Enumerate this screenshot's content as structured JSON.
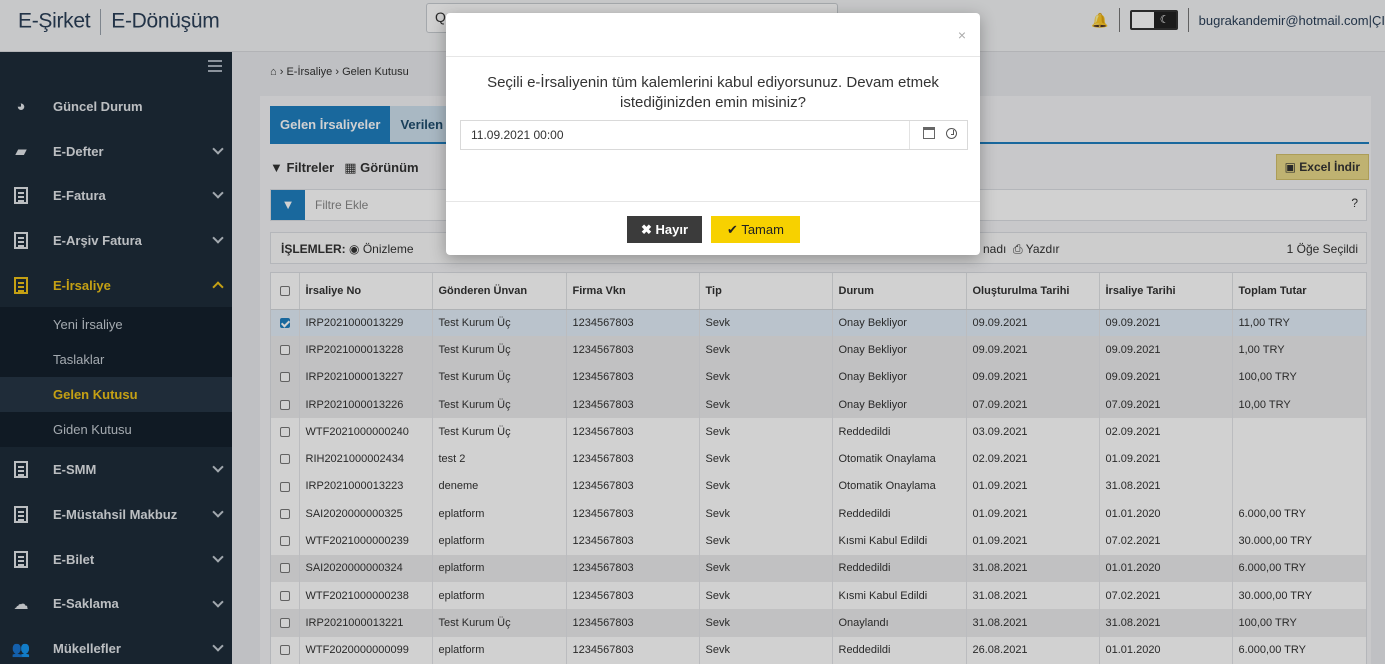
{
  "header": {
    "brand_left": "E-Şirket",
    "brand_right": "E-Dönüşüm",
    "user_email": "bugrakandemir@hotmail.com|ÇI"
  },
  "sidebar": {
    "items": [
      {
        "label": "Güncel Durum",
        "icon": "dashboard-icon"
      },
      {
        "label": "E-Defter",
        "icon": "book-icon"
      },
      {
        "label": "E-Fatura",
        "icon": "document-icon"
      },
      {
        "label": "E-Arşiv Fatura",
        "icon": "archive-icon"
      },
      {
        "label": "E-İrsaliye",
        "icon": "document-icon"
      },
      {
        "label": "E-SMM",
        "icon": "document-icon"
      },
      {
        "label": "E-Müstahsil Makbuz",
        "icon": "document-icon"
      },
      {
        "label": "E-Bilet",
        "icon": "document-icon"
      },
      {
        "label": "E-Saklama",
        "icon": "cloud-icon"
      },
      {
        "label": "Mükellefler",
        "icon": "users-icon"
      }
    ],
    "sub_items": [
      "Yeni İrsaliye",
      "Taslaklar",
      "Gelen Kutusu",
      "Giden Kutusu"
    ]
  },
  "breadcrumb": {
    "home": "E-İrsaliye",
    "current": "Gelen Kutusu"
  },
  "tabs": {
    "active": "Gelen İrsaliyeler",
    "other": "Verilen Cevaplar"
  },
  "toolbar": {
    "filters": "Filtreler",
    "view": "Görünüm",
    "excel": "Excel İndir",
    "filter_placeholder": "Filtre Ekle"
  },
  "ops": {
    "label": "İŞLEMLER:",
    "preview": "Önizleme",
    "partial": "nadı",
    "print": "Yazdır",
    "selected": "1 Öğe Seçildi"
  },
  "table": {
    "headers": [
      "İrsaliye No",
      "Gönderen Ünvan",
      "Firma Vkn",
      "Tip",
      "Durum",
      "Oluşturulma Tarihi",
      "İrsaliye Tarihi",
      "Toplam Tutar"
    ],
    "rows": [
      [
        "IRP2021000013229",
        "Test Kurum Üç",
        "1234567803",
        "Sevk",
        "Onay Bekliyor",
        "09.09.2021",
        "09.09.2021",
        "11,00 TRY"
      ],
      [
        "IRP2021000013228",
        "Test Kurum Üç",
        "1234567803",
        "Sevk",
        "Onay Bekliyor",
        "09.09.2021",
        "09.09.2021",
        "1,00 TRY"
      ],
      [
        "IRP2021000013227",
        "Test Kurum Üç",
        "1234567803",
        "Sevk",
        "Onay Bekliyor",
        "09.09.2021",
        "09.09.2021",
        "100,00 TRY"
      ],
      [
        "IRP2021000013226",
        "Test Kurum Üç",
        "1234567803",
        "Sevk",
        "Onay Bekliyor",
        "07.09.2021",
        "07.09.2021",
        "10,00 TRY"
      ],
      [
        "WTF2021000000240",
        "Test Kurum Üç",
        "1234567803",
        "Sevk",
        "Reddedildi",
        "03.09.2021",
        "02.09.2021",
        ""
      ],
      [
        "RIH2021000002434",
        "test 2",
        "1234567803",
        "Sevk",
        "Otomatik Onaylama",
        "02.09.2021",
        "01.09.2021",
        ""
      ],
      [
        "IRP2021000013223",
        "deneme",
        "1234567803",
        "Sevk",
        "Otomatik Onaylama",
        "01.09.2021",
        "31.08.2021",
        ""
      ],
      [
        "SAI2020000000325",
        "eplatform",
        "1234567803",
        "Sevk",
        "Reddedildi",
        "01.09.2021",
        "01.01.2020",
        "6.000,00 TRY"
      ],
      [
        "WTF2021000000239",
        "eplatform",
        "1234567803",
        "Sevk",
        "Kısmi Kabul Edildi",
        "01.09.2021",
        "07.02.2021",
        "30.000,00 TRY"
      ],
      [
        "SAI2020000000324",
        "eplatform",
        "1234567803",
        "Sevk",
        "Reddedildi",
        "31.08.2021",
        "01.01.2020",
        "6.000,00 TRY"
      ],
      [
        "WTF2021000000238",
        "eplatform",
        "1234567803",
        "Sevk",
        "Kısmi Kabul Edildi",
        "31.08.2021",
        "07.02.2021",
        "30.000,00 TRY"
      ],
      [
        "IRP2021000013221",
        "Test Kurum Üç",
        "1234567803",
        "Sevk",
        "Onaylandı",
        "31.08.2021",
        "31.08.2021",
        "100,00 TRY"
      ],
      [
        "WTF2020000000099",
        "eplatform",
        "1234567803",
        "Sevk",
        "Reddedildi",
        "26.08.2021",
        "01.01.2020",
        "6.000,00 TRY"
      ]
    ]
  },
  "modal": {
    "message": "Seçili e-İrsaliyenin tüm kalemlerini kabul ediyorsunuz. Devam etmek istediğinizden emin misiniz?",
    "datetime_value": "11.09.2021 00:00",
    "close": "×",
    "no_label": "Hayır",
    "ok_label": "Tamam"
  }
}
